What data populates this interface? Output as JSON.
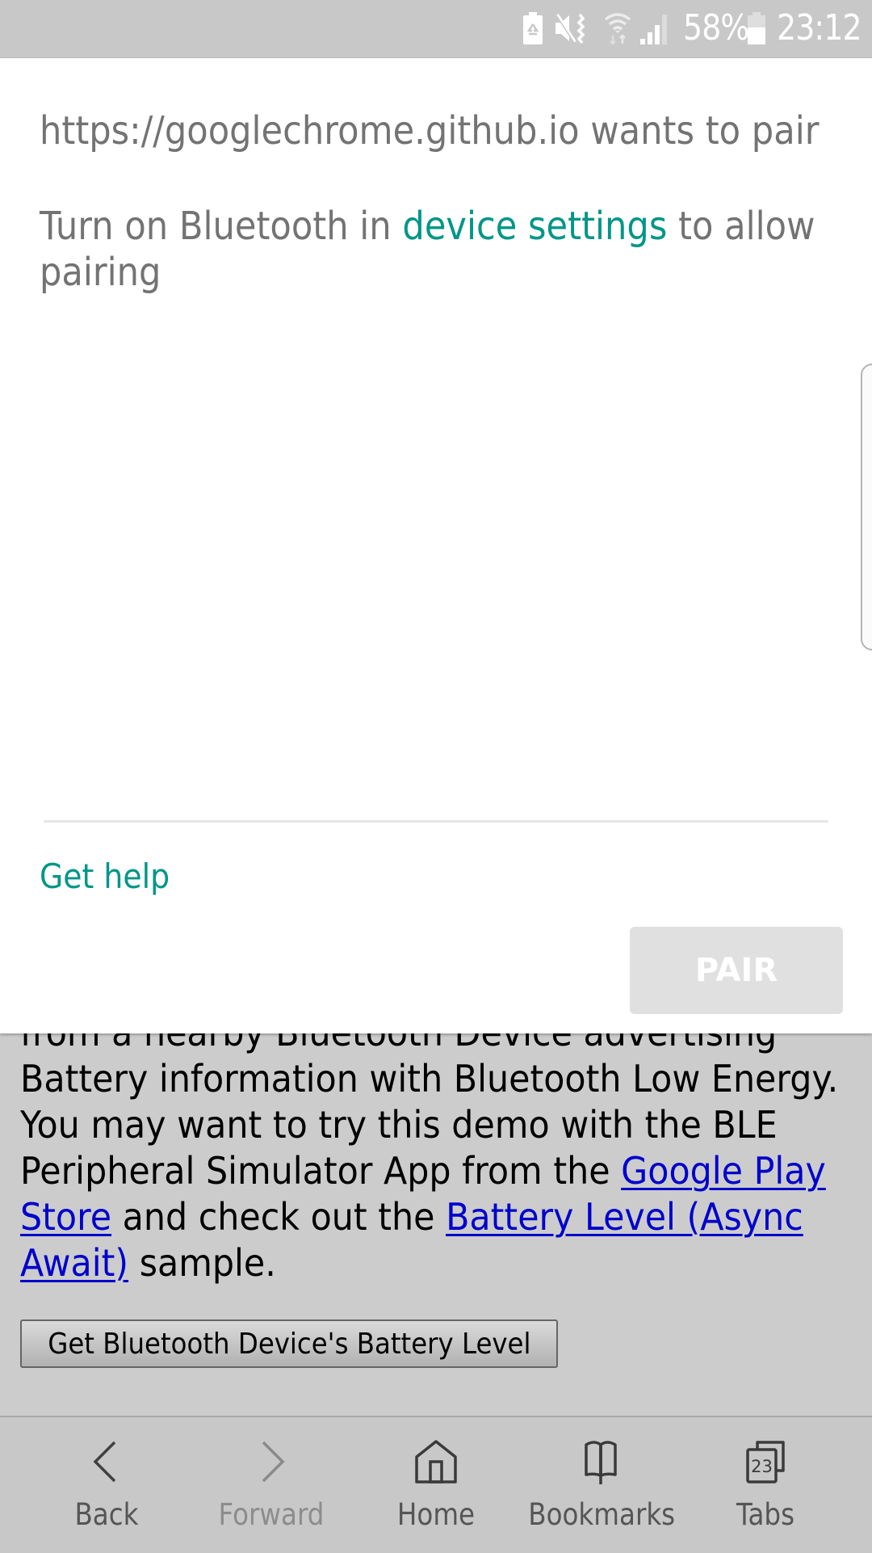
{
  "status_bar": {
    "icons": [
      "battery-saver-icon",
      "mute-vibrate-icon",
      "wifi-icon",
      "cellular-signal-icon",
      "battery-icon"
    ],
    "battery_percent": "58%",
    "battery_level": 0.58,
    "time": "23:12"
  },
  "dialog": {
    "title": "https://googlechrome.github.io wants to pair",
    "message_prefix": "Turn on Bluetooth in ",
    "message_link": "device settings",
    "message_suffix_line1": " to allow",
    "message_line2": "pairing",
    "help_link": "Get help",
    "pair_button": "PAIR",
    "pair_enabled": false,
    "accent_color": "#009688"
  },
  "page": {
    "lines": [
      {
        "text": "from a nearby Bluetooth Device advertising"
      },
      {
        "text": "Battery information with Bluetooth Low Energy."
      },
      {
        "text": "You may want to try this demo with the BLE"
      },
      {
        "pre": "Peripheral Simulator App from the ",
        "link": "Google Play"
      },
      {
        "link": "Store",
        "mid": " and check out the ",
        "link2": "Battery Level (Async"
      },
      {
        "link": "Await)",
        "post": " sample."
      }
    ],
    "button": "Get Bluetooth Device's Battery Level",
    "link_color": "#0000cc"
  },
  "bottom_nav": {
    "items": [
      {
        "label": "Back",
        "icon": "chevron-left-icon",
        "enabled": true
      },
      {
        "label": "Forward",
        "icon": "chevron-right-icon",
        "enabled": false
      },
      {
        "label": "Home",
        "icon": "home-icon",
        "enabled": true
      },
      {
        "label": "Bookmarks",
        "icon": "bookmarks-icon",
        "enabled": true
      },
      {
        "label": "Tabs",
        "icon": "tabs-icon",
        "enabled": true,
        "count": "23"
      }
    ]
  }
}
